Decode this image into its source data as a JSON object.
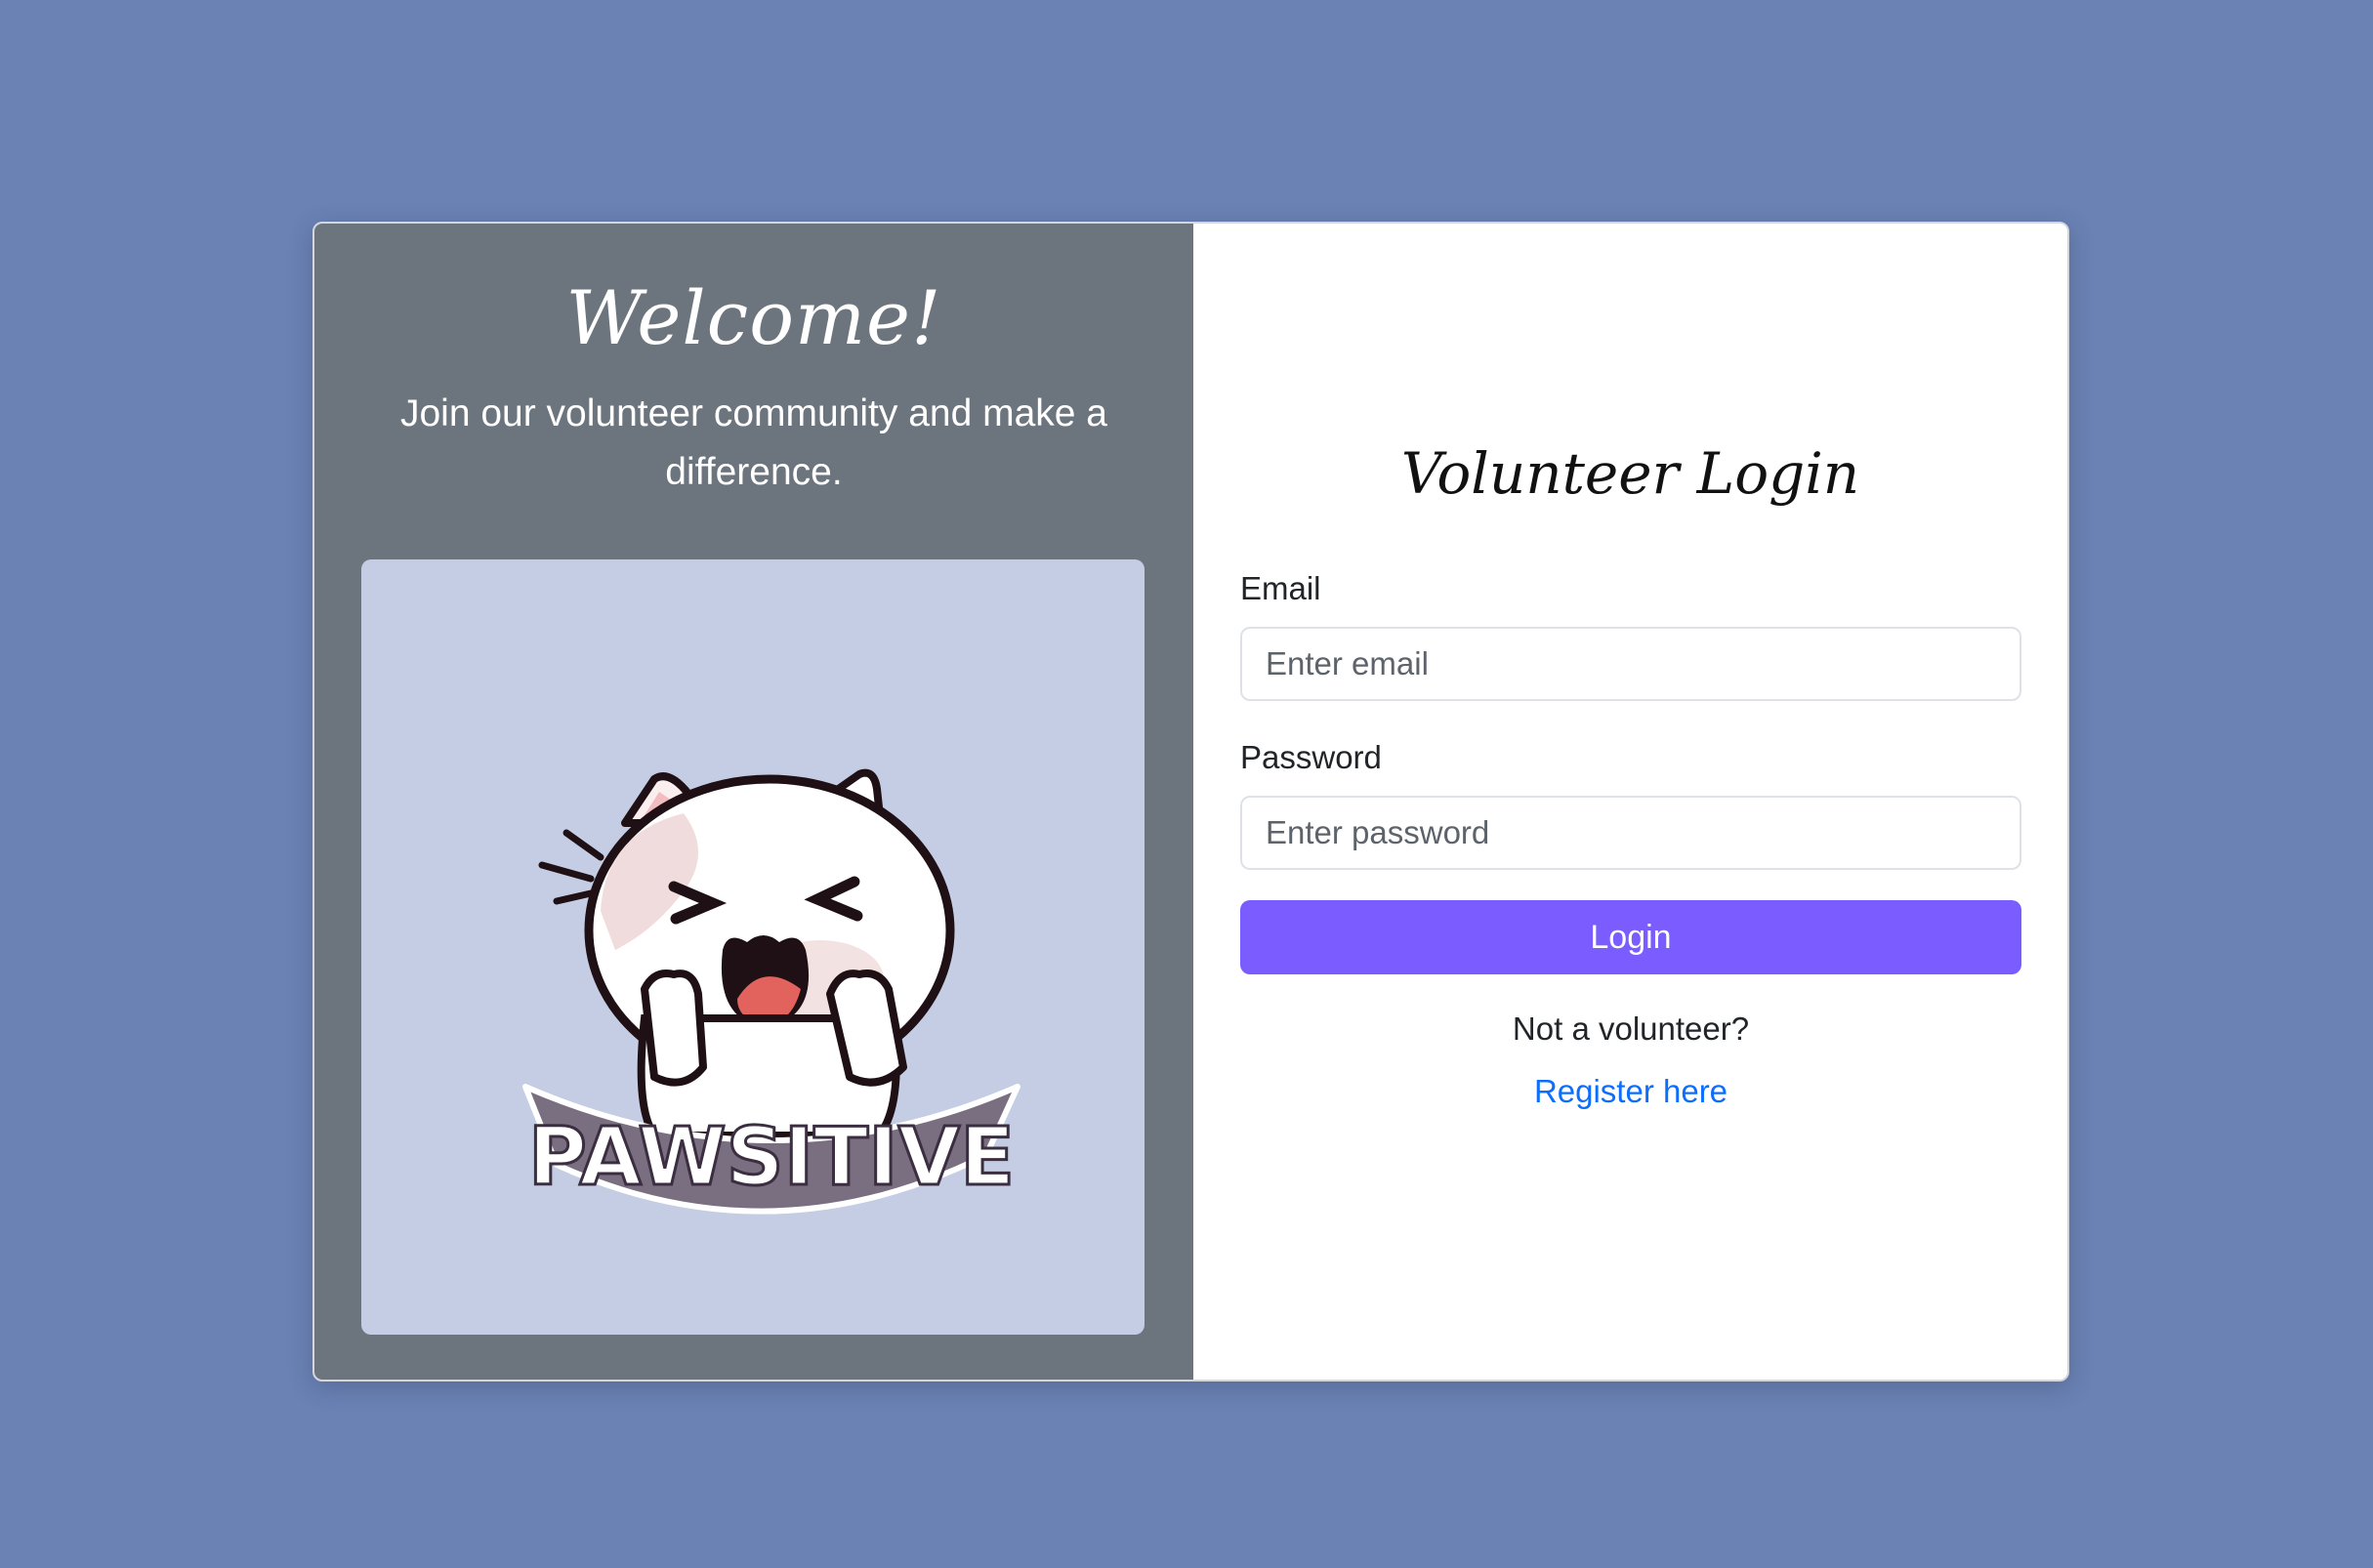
{
  "welcome": {
    "title": "Welcome!",
    "subtitle": "Join our volunteer community and make a difference."
  },
  "image": {
    "logo_text": "PAWSITIVE",
    "icon": "cat-mascot-icon"
  },
  "form": {
    "title": "Volunteer Login",
    "email_label": "Email",
    "email_placeholder": "Enter email",
    "password_label": "Password",
    "password_placeholder": "Enter password",
    "login_label": "Login",
    "not_volunteer_text": "Not a volunteer?",
    "register_label": "Register here"
  },
  "colors": {
    "page_background": "#6a82b4",
    "panel_background": "#6c757d",
    "image_background": "#c4cde3",
    "button": "#7a5cff",
    "link": "#0d6efd"
  }
}
